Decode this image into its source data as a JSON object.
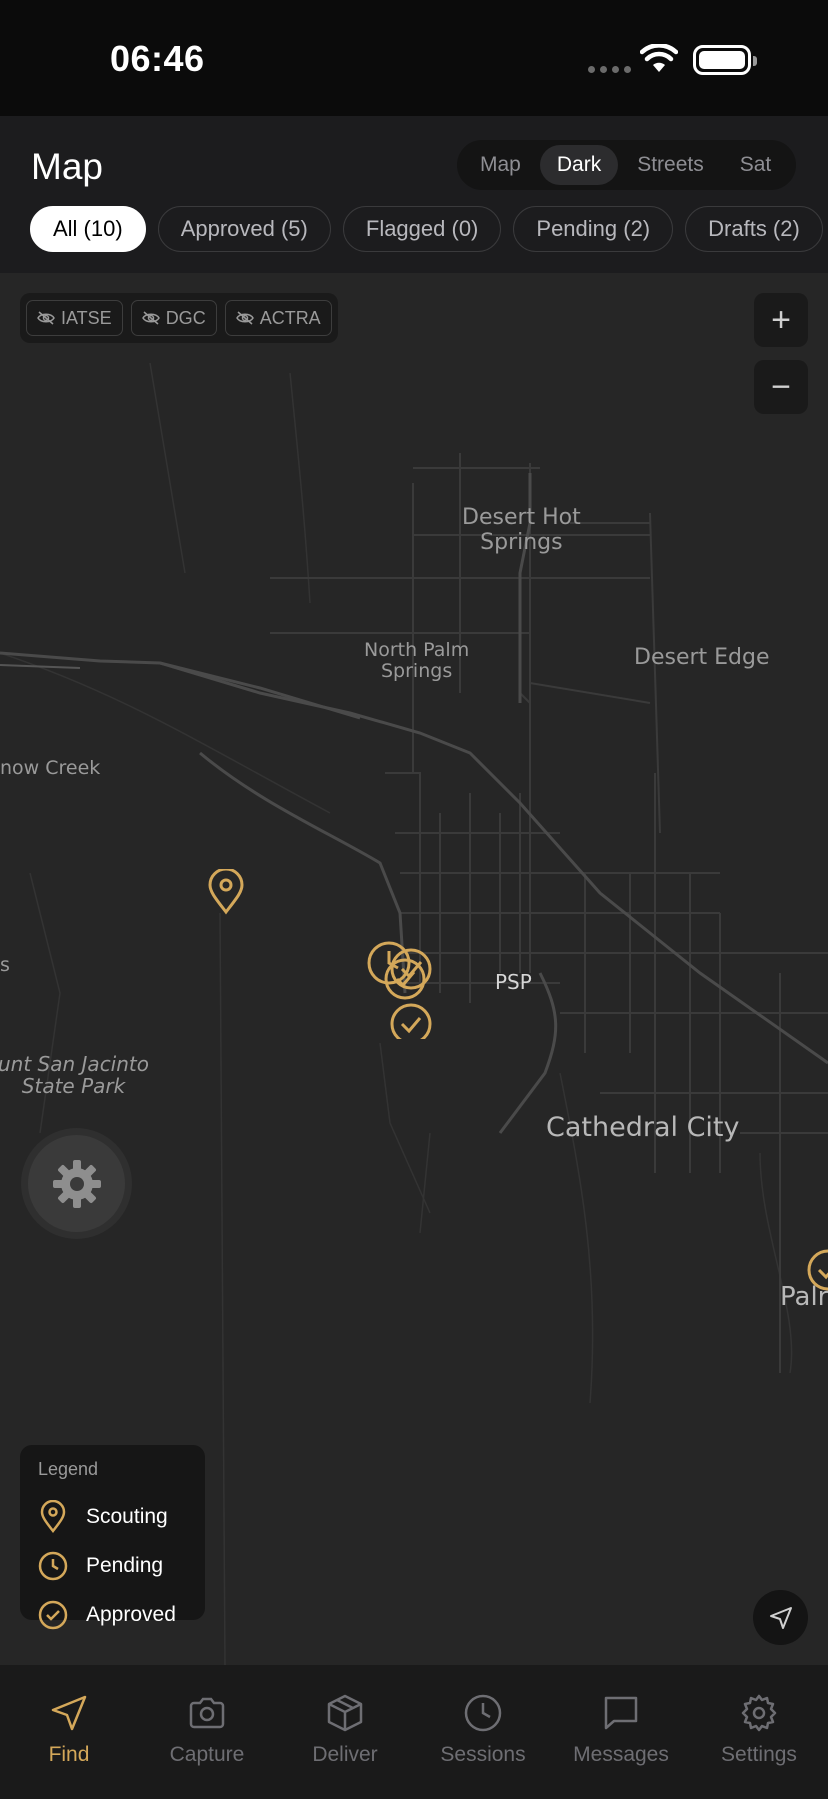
{
  "status": {
    "time": "06:46"
  },
  "header": {
    "title": "Map",
    "layers": [
      {
        "label": "Map",
        "active": false
      },
      {
        "label": "Dark",
        "active": true
      },
      {
        "label": "Streets",
        "active": false
      },
      {
        "label": "Sat",
        "active": false
      }
    ],
    "filters": [
      {
        "label": "All (10)",
        "active": true
      },
      {
        "label": "Approved (5)",
        "active": false
      },
      {
        "label": "Flagged (0)",
        "active": false
      },
      {
        "label": "Pending (2)",
        "active": false
      },
      {
        "label": "Drafts (2)",
        "active": false
      }
    ]
  },
  "map": {
    "unions": [
      {
        "label": "IATSE",
        "icon": "eye-off-icon"
      },
      {
        "label": "DGC",
        "icon": "eye-off-icon"
      },
      {
        "label": "ACTRA",
        "icon": "eye-off-icon"
      }
    ],
    "zoom_in": "+",
    "zoom_out": "−",
    "places": {
      "desert_hot_springs": "Desert Hot\nSprings",
      "north_palm_springs": "North Palm\nSprings",
      "desert_edge": "Desert Edge",
      "snow_creek": "now Creek",
      "s_edge": "s",
      "psp": "PSP",
      "mount_san_jacinto": "unt San Jacinto\nState Park",
      "cathedral_city": "Cathedral City",
      "palm": "Palr"
    },
    "accent_color": "#d4a85a"
  },
  "legend": {
    "title": "Legend",
    "items": [
      {
        "label": "Scouting",
        "icon": "pin-icon"
      },
      {
        "label": "Pending",
        "icon": "clock-icon"
      },
      {
        "label": "Approved",
        "icon": "check-circle-icon"
      }
    ]
  },
  "tabs": [
    {
      "label": "Find",
      "icon": "navigation-icon",
      "active": true
    },
    {
      "label": "Capture",
      "icon": "camera-icon",
      "active": false
    },
    {
      "label": "Deliver",
      "icon": "box-icon",
      "active": false
    },
    {
      "label": "Sessions",
      "icon": "clock-icon",
      "active": false
    },
    {
      "label": "Messages",
      "icon": "message-icon",
      "active": false
    },
    {
      "label": "Settings",
      "icon": "gear-icon",
      "active": false
    }
  ]
}
